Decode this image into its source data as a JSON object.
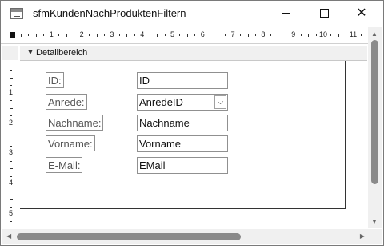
{
  "window": {
    "title": "sfmKundenNachProduktenFiltern"
  },
  "section": {
    "label": "Detailbereich"
  },
  "ruler": {
    "h_labels": [
      "1",
      "2",
      "3",
      "4",
      "5",
      "6",
      "7",
      "8",
      "9",
      "10",
      "11"
    ],
    "v_labels": [
      "1",
      "2",
      "3",
      "4",
      "5"
    ]
  },
  "fields": [
    {
      "label": "ID:",
      "control": "ID",
      "type": "textbox"
    },
    {
      "label": "Anrede:",
      "control": "AnredeID",
      "type": "combobox"
    },
    {
      "label": "Nachname:",
      "control": "Nachname",
      "type": "textbox"
    },
    {
      "label": "Vorname:",
      "control": "Vorname",
      "type": "textbox"
    },
    {
      "label": "E-Mail:",
      "control": "EMail",
      "type": "textbox"
    }
  ],
  "icons": {
    "app": "form-design-icon",
    "section_arrow": "caret-down-icon",
    "combo": "chevron-down-icon"
  }
}
